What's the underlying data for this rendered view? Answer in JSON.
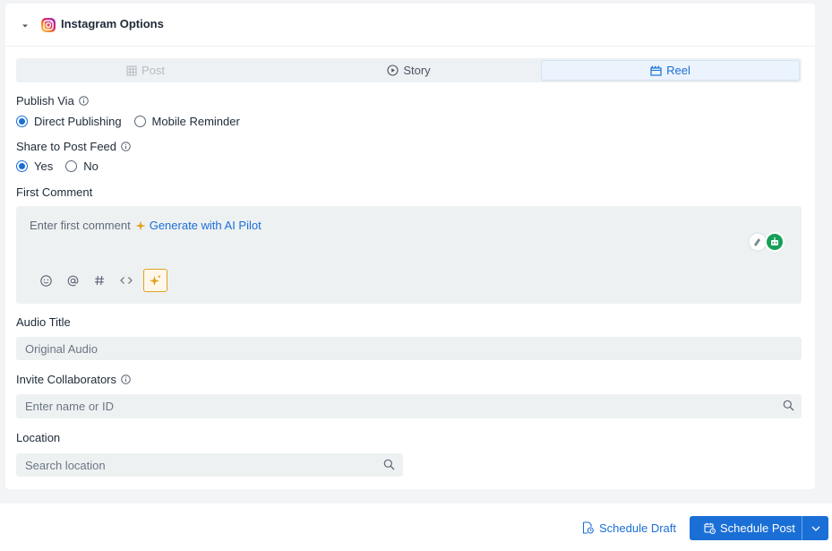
{
  "panel": {
    "title": "Instagram Options"
  },
  "tabs": [
    {
      "label": "Post",
      "icon": "grid-icon",
      "state": "disabled"
    },
    {
      "label": "Story",
      "icon": "play-circle-icon",
      "state": "normal"
    },
    {
      "label": "Reel",
      "icon": "clapper-icon",
      "state": "active"
    }
  ],
  "publish_via": {
    "label": "Publish Via",
    "options": [
      "Direct Publishing",
      "Mobile Reminder"
    ],
    "selected": "Direct Publishing"
  },
  "share_feed": {
    "label": "Share to Post Feed",
    "options": [
      "Yes",
      "No"
    ],
    "selected": "Yes"
  },
  "first_comment": {
    "label": "First Comment",
    "placeholder": "Enter first comment",
    "ai_link": "Generate with AI Pilot"
  },
  "audio": {
    "label": "Audio Title",
    "placeholder": "Original Audio"
  },
  "collaborators": {
    "label": "Invite Collaborators",
    "placeholder": "Enter name or ID"
  },
  "location": {
    "label": "Location",
    "placeholder": "Search location"
  },
  "footer": {
    "draft_label": "Schedule Draft",
    "schedule_label": "Schedule Post"
  },
  "colors": {
    "accent": "#1a6fd6",
    "ai_highlight": "#e0a220",
    "input_bg": "#eef1f2"
  }
}
